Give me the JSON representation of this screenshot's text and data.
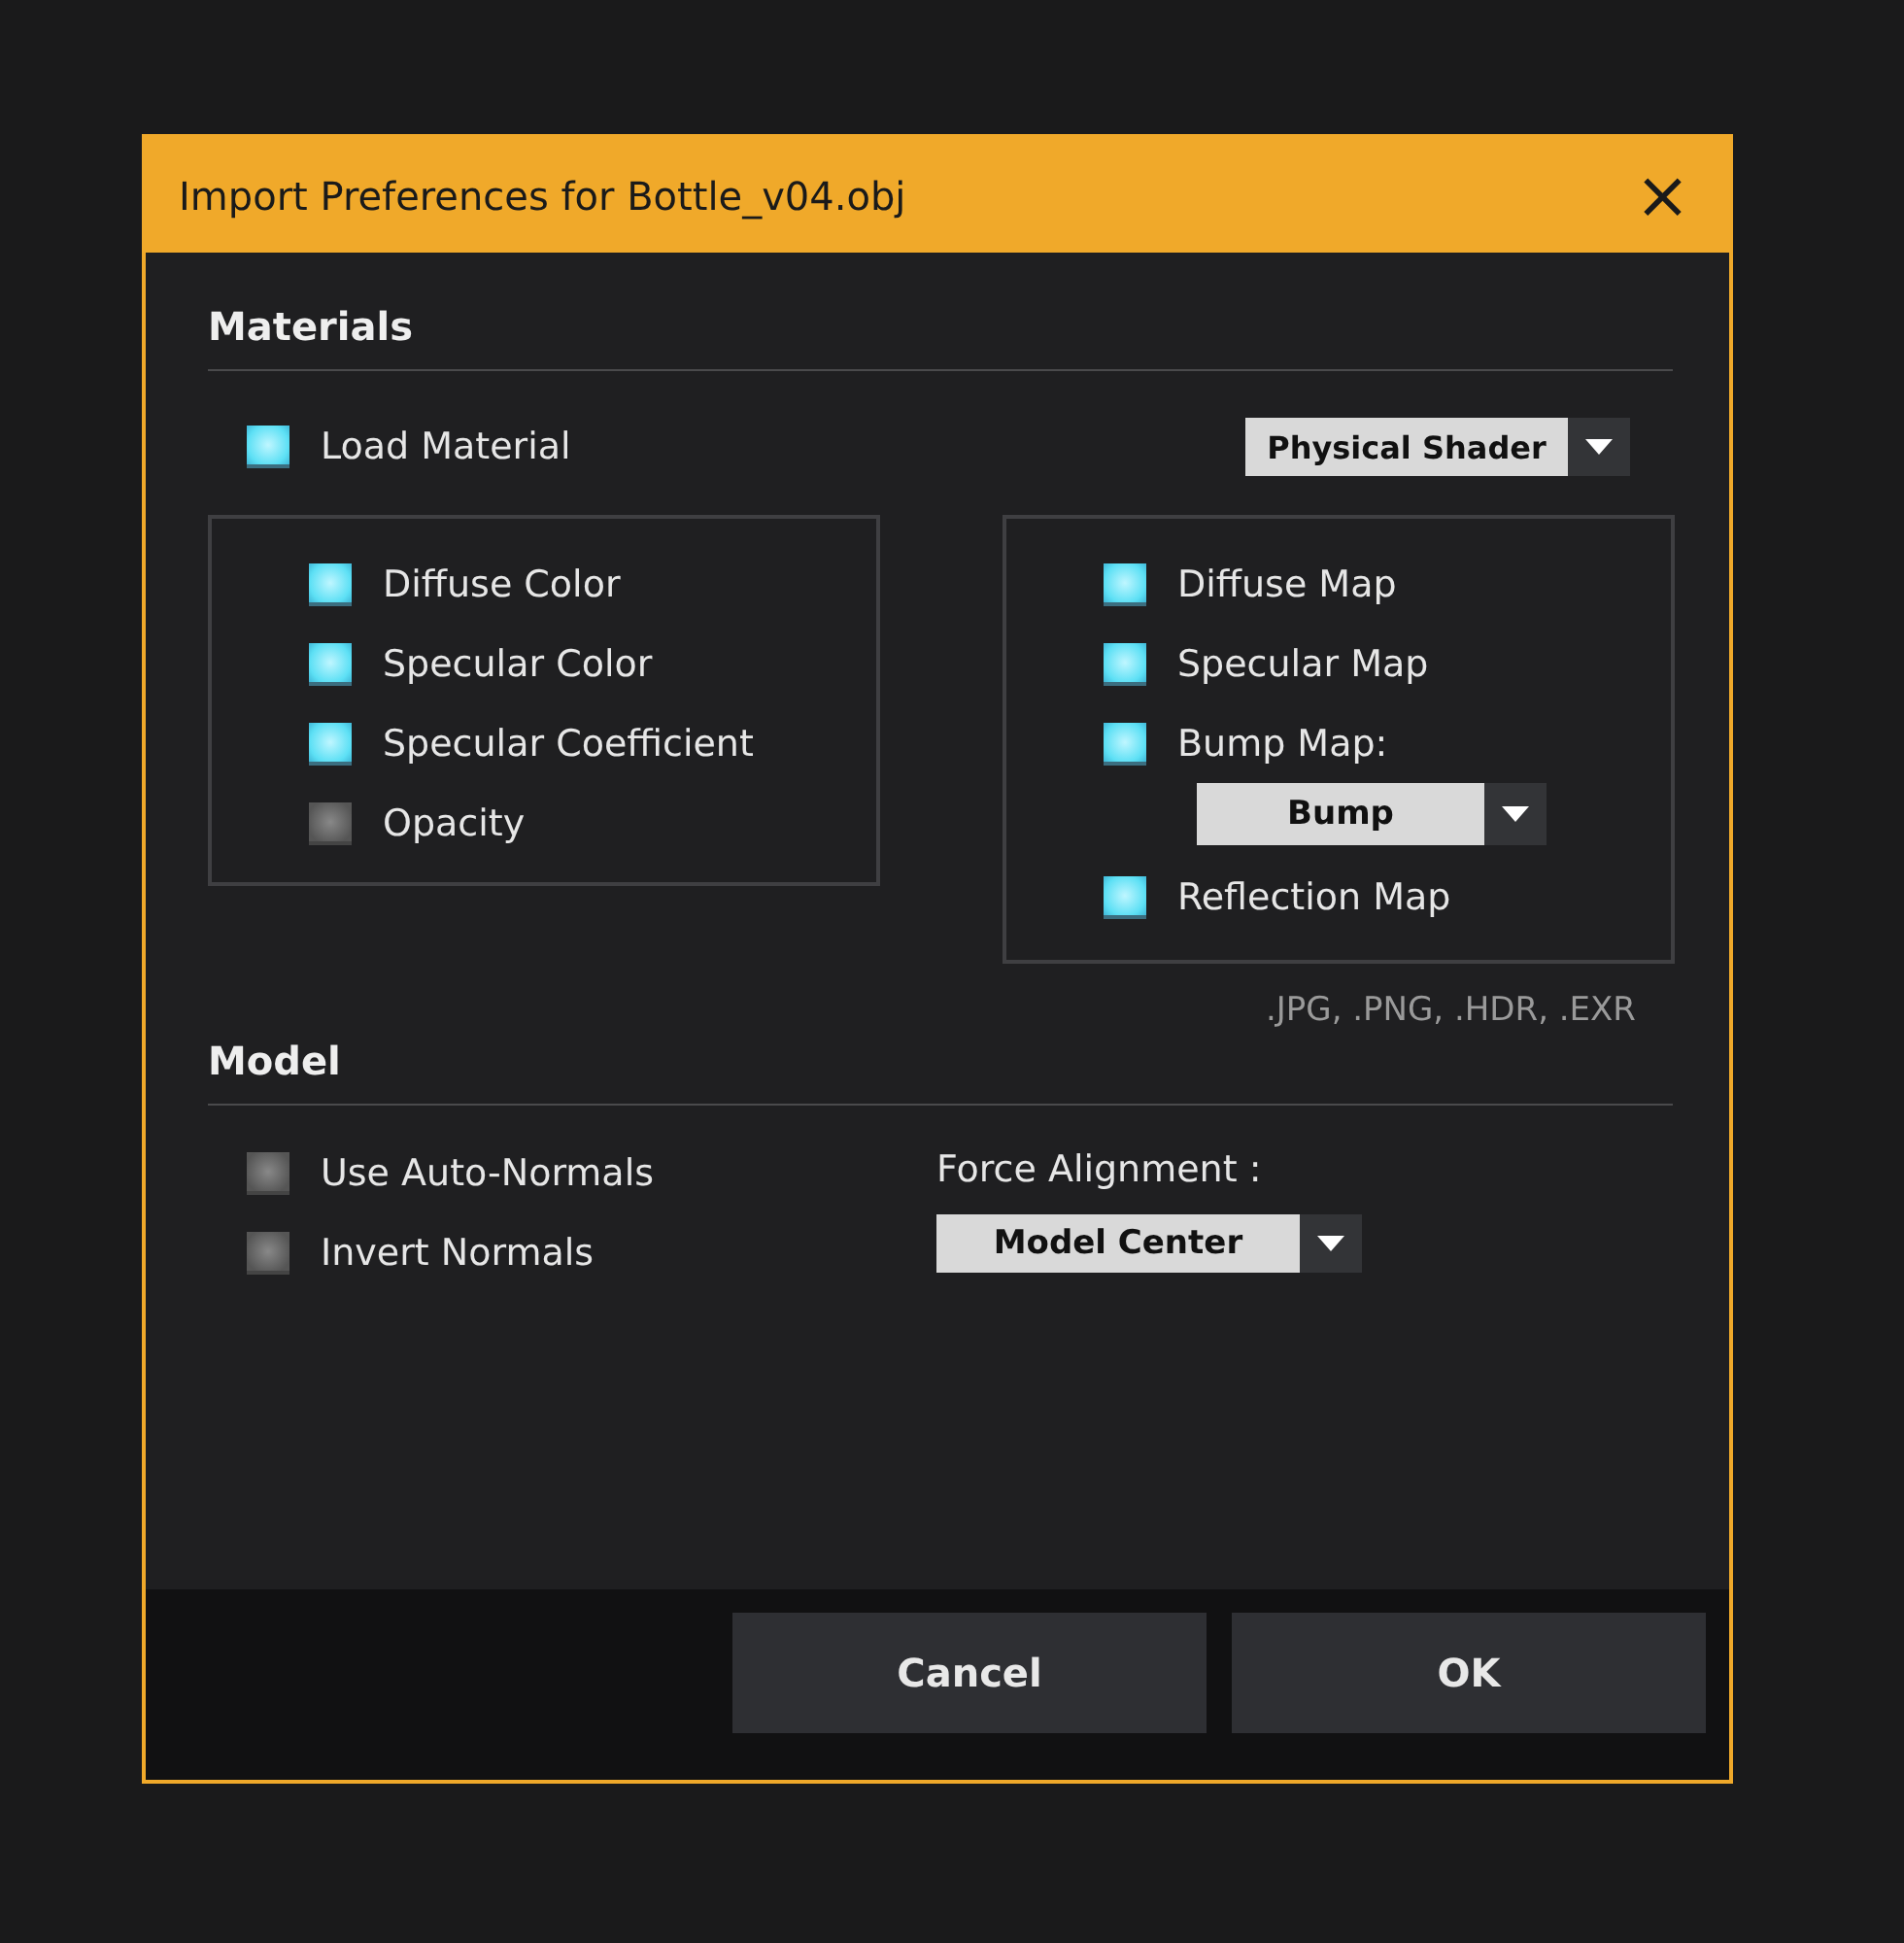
{
  "window": {
    "title": "Import Preferences for Bottle_v04.obj",
    "close": "×"
  },
  "materials": {
    "heading": "Materials",
    "load_material": {
      "label": "Load Material",
      "checked": true
    },
    "shader": {
      "value": "Physical Shader"
    },
    "color_options": [
      {
        "label": "Diffuse Color",
        "checked": true
      },
      {
        "label": "Specular Color",
        "checked": true
      },
      {
        "label": "Specular Coefficient",
        "checked": true
      },
      {
        "label": "Opacity",
        "checked": false
      }
    ],
    "map_options": [
      {
        "kind": "checkbox",
        "label": "Diffuse Map",
        "checked": true
      },
      {
        "kind": "checkbox",
        "label": "Specular Map",
        "checked": true
      },
      {
        "kind": "checkbox",
        "label": "Bump Map:",
        "checked": true
      },
      {
        "kind": "dropdown",
        "value": "Bump"
      },
      {
        "kind": "checkbox",
        "label": "Reflection Map",
        "checked": true
      }
    ],
    "formats": ".JPG, .PNG, .HDR, .EXR"
  },
  "model": {
    "heading": "Model",
    "options": [
      {
        "label": "Use Auto-Normals",
        "checked": false
      },
      {
        "label": "Invert Normals",
        "checked": false
      }
    ],
    "alignment_label": "Force Alignment :",
    "alignment": {
      "value": "Model Center"
    }
  },
  "buttons": [
    "Cancel",
    "OK"
  ]
}
